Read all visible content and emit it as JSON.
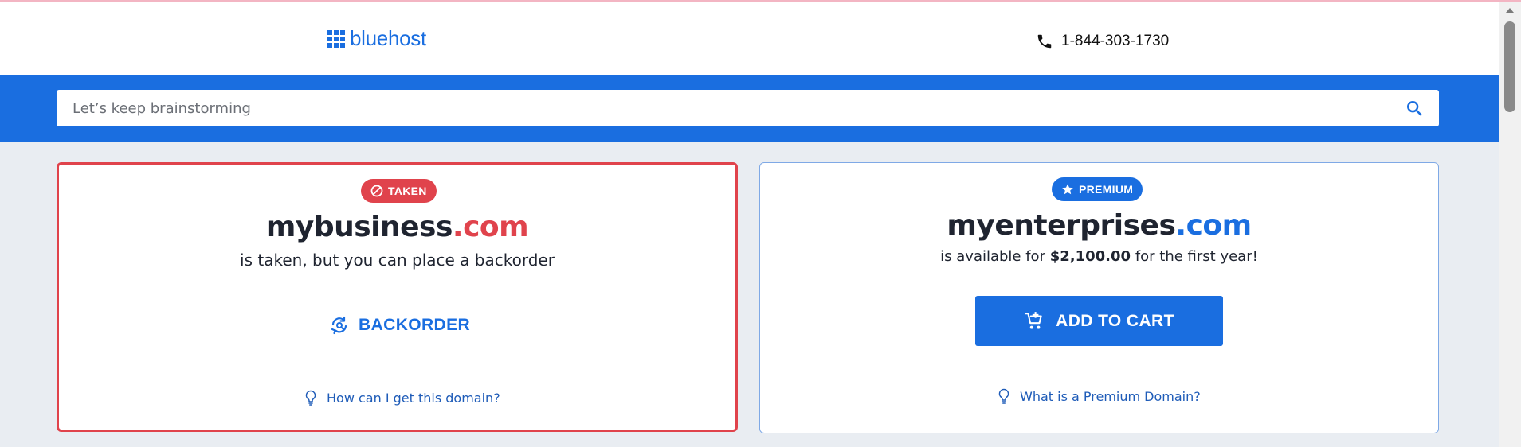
{
  "header": {
    "logo_text": "bluehost",
    "phone": "1-844-303-1730"
  },
  "search": {
    "placeholder": "Let’s keep brainstorming",
    "value": ""
  },
  "taken_card": {
    "badge": "TAKEN",
    "domain_name": "mybusiness",
    "domain_tld": ".com",
    "subtitle": "is taken, but you can place a backorder",
    "button_label": "BACKORDER",
    "help_link": "How can I get this domain?"
  },
  "premium_card": {
    "badge": "PREMIUM",
    "domain_name": "myenterprises",
    "domain_tld": ".com",
    "subtitle_prefix": "is available for",
    "price": "$2,100.00",
    "subtitle_suffix": "for the first year!",
    "button_label": "ADD TO CART",
    "help_link": "What is a Premium Domain?"
  },
  "colors": {
    "brand_blue": "#1a6ee0",
    "taken_red": "#e0434c",
    "page_bg": "#e9edf2"
  },
  "icons": {
    "logo": "grid-icon",
    "phone": "phone-icon",
    "search": "search-icon",
    "taken": "block-icon",
    "premium": "star-icon",
    "backorder": "refresh-search-icon",
    "cart": "add-cart-icon",
    "help": "lightbulb-icon"
  }
}
